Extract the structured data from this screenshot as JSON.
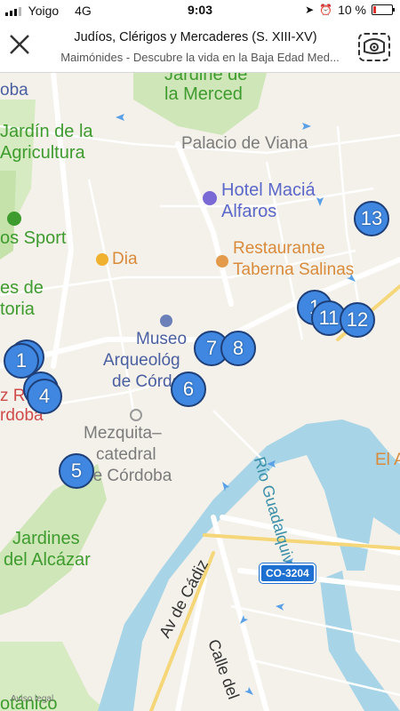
{
  "status_bar": {
    "carrier": "Yoigo",
    "network": "4G",
    "time": "9:03",
    "battery_text": "10 %"
  },
  "header": {
    "title": "Judíos, Clérigos y Mercaderes (S. XIII-XV)",
    "subtitle": "Maimónides - Descubre la vida en la Baja Edad Med..."
  },
  "map": {
    "labels": {
      "jardine_merced_1": "Jardine de",
      "jardine_merced_2": "la Merced",
      "oba": "oba",
      "palacio": "Palacio de Viana",
      "jardin_agri_1": "Jardín de la",
      "jardin_agri_2": "Agricultura",
      "hotel_1": "Hotel Maciá",
      "hotel_2": "Alfaros",
      "sport": "os Sport",
      "restaurante_1": "Restaurante",
      "restaurante_2": "Taberna Salinas",
      "dia": "Dia",
      "es_de": "es de",
      "toria": "toria",
      "museo_1": "Museo",
      "museo_2": "Arqueológ",
      "museo_3": "de Córdoba",
      "z_r": "z R",
      "rdoba": "rdoba",
      "mezquita_1": "Mezquita–",
      "mezquita_2": "catedral",
      "mezquita_3": "de Córdoba",
      "el_a": "El A",
      "rio": "Río Guadalquivir",
      "jardines_alcazar_1": "Jardines",
      "jardines_alcazar_2": "del Alcázar",
      "av_cadiz": "Av de Cádiz",
      "calle_del": "Calle del",
      "botanico": "otánico"
    },
    "road_badge": "CO-3204",
    "attribution": "Aviso legal",
    "markers": [
      "1",
      "4",
      "5",
      "6",
      "7",
      "8",
      "1",
      "11",
      "12",
      "13"
    ]
  },
  "colors": {
    "marker_fill": "#3f87e0",
    "marker_border": "#1e3f78",
    "water": "#a7d4e6",
    "park": "#cfe6b8"
  }
}
